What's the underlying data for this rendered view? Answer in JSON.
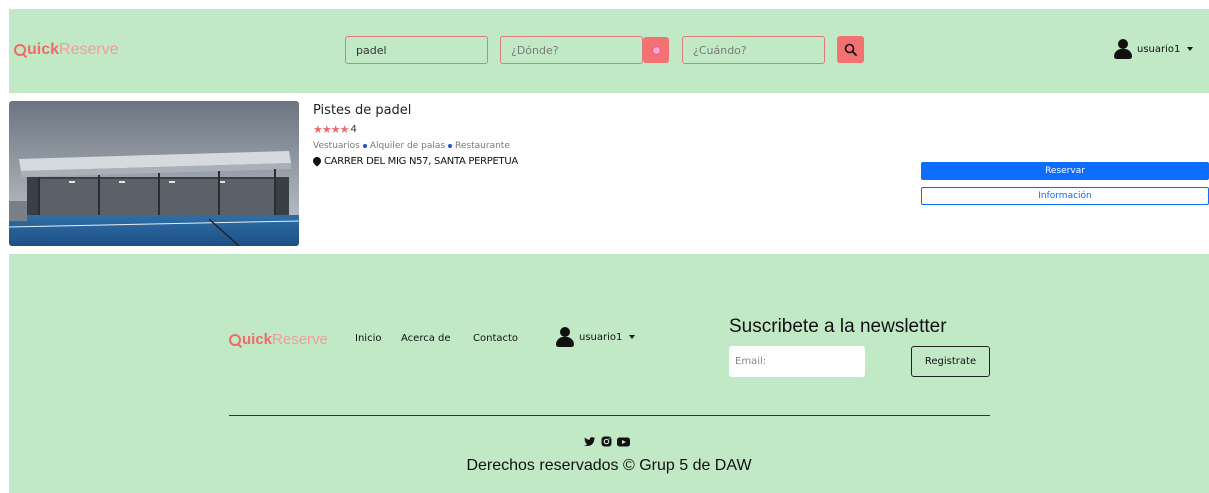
{
  "header": {
    "logo": {
      "mark": "uick",
      "rest": "Reserve"
    },
    "search": {
      "query_value": "padel",
      "where_placeholder": "¿Dónde?",
      "when_placeholder": "¿Cuándo?"
    },
    "user": {
      "name": "usuario1"
    }
  },
  "result": {
    "title": "Pistes de padel",
    "stars": "★★★★",
    "rating": "4",
    "amenities": [
      "Vestuarios",
      "Alquiler de palas",
      "Restaurante"
    ],
    "address": "CARRER DEL MIG N57, SANTA PERPETUA",
    "reserve_label": "Reservar",
    "info_label": "Información"
  },
  "footer": {
    "logo": {
      "mark": "uick",
      "rest": "Reserve"
    },
    "nav": [
      "Inicio",
      "Acerca de",
      "Contacto"
    ],
    "user": {
      "name": "usuario1"
    },
    "newsletter": {
      "title": "Suscribete a la newsletter",
      "email_placeholder": "Email:",
      "button_label": "Registrate"
    },
    "socials": [
      "twitter-icon",
      "instagram-icon",
      "youtube-icon"
    ],
    "copyright": "Derechos reservados © Grup 5 de DAW"
  },
  "colors": {
    "green_bg": "#c2e9c6",
    "accent": "#f27171",
    "primary": "#0d6efd"
  }
}
